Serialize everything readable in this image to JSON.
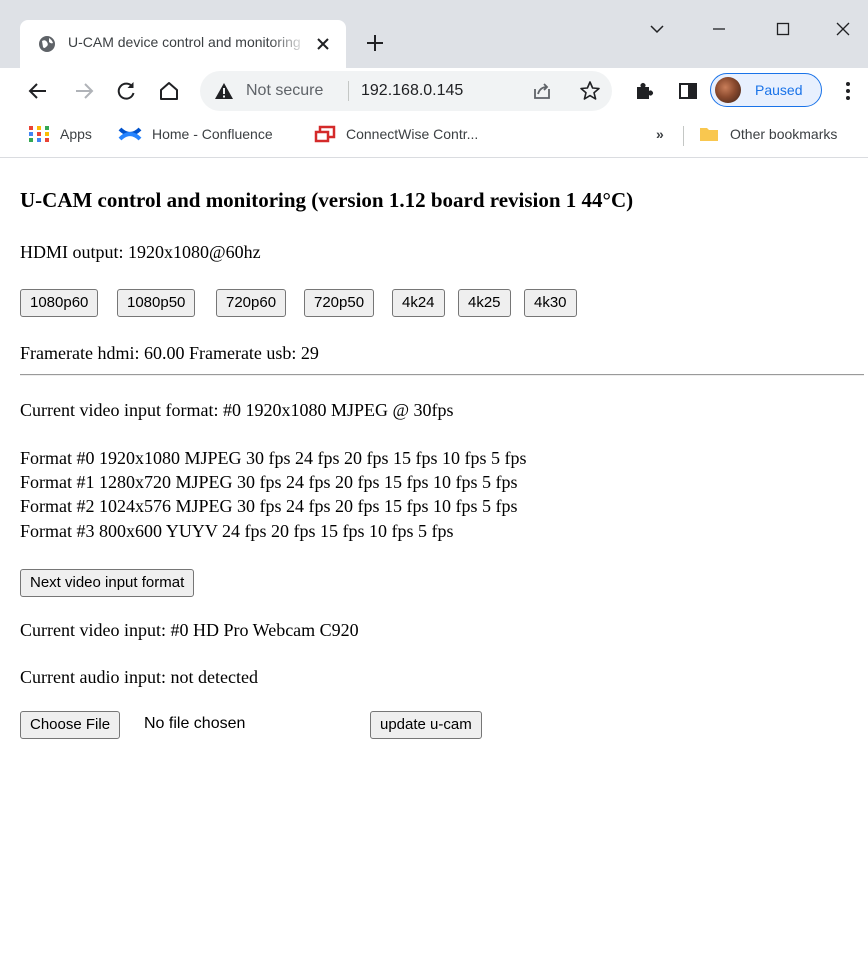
{
  "browser": {
    "tab_title": "U-CAM device control and monitoring",
    "address": {
      "security_label": "Not secure",
      "url": "192.168.0.145"
    },
    "profile_label": "Paused",
    "bookmarks": [
      {
        "label": "Apps",
        "icon": "apps-grid-icon"
      },
      {
        "label": "Home - Confluence",
        "icon": "confluence-icon"
      },
      {
        "label": "ConnectWise Contr...",
        "icon": "connectwise-icon"
      }
    ],
    "bookmarks_overflow": "»",
    "other_bookmarks_label": "Other bookmarks",
    "colors": {
      "accent": "#1a73e8",
      "frame": "#dee1e6",
      "omnibox": "#f1f3f4",
      "apps_dots": [
        "#ea4335",
        "#fbbc04",
        "#34a853",
        "#4285f4"
      ],
      "confluence": "#0052cc",
      "connectwise": "#d42a2a",
      "folder": "#f9c74f"
    }
  },
  "page": {
    "title": "U-CAM control and monitoring (version 1.12 board revision 1 44°C)",
    "hdmi_output": "HDMI output: 1920x1080@60hz",
    "resolution_buttons": [
      "1080p60",
      "1080p50",
      "720p60",
      "720p50",
      "4k24",
      "4k25",
      "4k30"
    ],
    "framerate": "Framerate hdmi: 60.00 Framerate usb: 29",
    "current_video_format": "Current video input format: #0 1920x1080 MJPEG @ 30fps",
    "formats": [
      "Format #0 1920x1080 MJPEG 30 fps 24 fps 20 fps 15 fps 10 fps 5 fps",
      "Format #1 1280x720 MJPEG 30 fps 24 fps 20 fps 15 fps 10 fps 5 fps",
      "Format #2 1024x576 MJPEG 30 fps 24 fps 20 fps 15 fps 10 fps 5 fps",
      "Format #3 800x600 YUYV 24 fps 20 fps 15 fps 10 fps 5 fps"
    ],
    "next_format_button": "Next video input format",
    "current_video_input": "Current video input: #0 HD Pro Webcam C920",
    "current_audio_input": "Current audio input: not detected",
    "choose_file_button": "Choose File",
    "no_file_label": "No file chosen",
    "update_button": "update u-cam"
  }
}
